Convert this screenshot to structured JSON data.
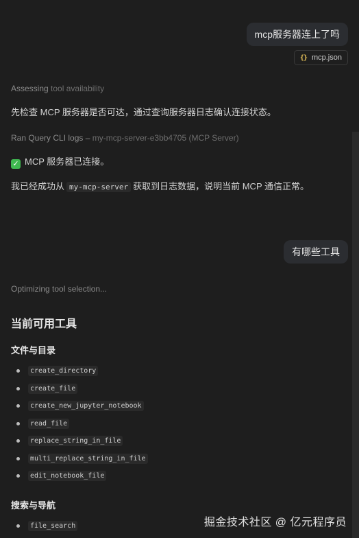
{
  "messages": {
    "first_user": "mcp服务器连上了吗",
    "attachment_label": "mcp.json",
    "assessing_prefix": "Assessing",
    "assessing_suffix": "tool availability",
    "check_text": "先检查 MCP 服务器是否可达，通过查询服务器日志确认连接状态。",
    "ran_prefix": "Ran Query CLI logs –",
    "ran_suffix": "my-mcp-server-e3bb4705 (MCP Server)",
    "connected_text": "MCP 服务器已连接。",
    "success_prefix": "我已经成功从",
    "success_code": "my-mcp-server",
    "success_suffix": "获取到日志数据，说明当前 MCP 通信正常。",
    "second_user": "有哪些工具",
    "optimizing_text": "Optimizing tool selection..."
  },
  "tools_section": {
    "title": "当前可用工具",
    "files_heading": "文件与目录",
    "files": [
      "create_directory",
      "create_file",
      "create_new_jupyter_notebook",
      "read_file",
      "replace_string_in_file",
      "multi_replace_string_in_file",
      "edit_notebook_file"
    ],
    "search_heading": "搜索与导航",
    "search": [
      "file_search"
    ]
  },
  "watermark": "掘金技术社区 @ 亿元程序员",
  "icons": {
    "attachment": "braces-icon",
    "status": "check-icon"
  },
  "colors": {
    "background": "#1e1e1e",
    "bubble": "#2b2d31",
    "success": "#3fb950",
    "braces": "#e8c35a"
  }
}
